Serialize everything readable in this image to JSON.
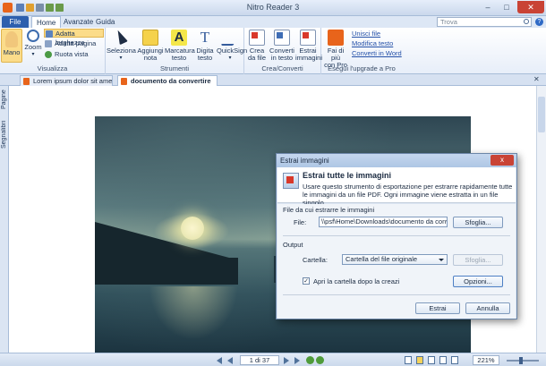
{
  "app": {
    "title": "Nitro Reader 3"
  },
  "ribbon_tabs": [
    "File",
    "Home",
    "Avanzate",
    "Guida"
  ],
  "search": {
    "placeholder": "Trova"
  },
  "ribbon": {
    "visualizza": {
      "label": "Visualizza",
      "mano": "Mano",
      "zoom": "Zoom",
      "adatta_larghezza": "Adatta larghezza",
      "adatta_pagina": "Adatta pagina",
      "ruota_vista": "Ruota vista"
    },
    "strumenti": {
      "label": "Strumenti",
      "seleziona": "Seleziona",
      "aggiungi_nota": [
        "Aggiungi",
        "nota"
      ],
      "marcatura_testo": [
        "Marcatura",
        "testo"
      ],
      "digita_testo": [
        "Digita",
        "testo"
      ],
      "quicksign": "QuickSign"
    },
    "crea_converti": {
      "label": "Crea/Converti",
      "crea_da_file": [
        "Crea",
        "da file"
      ],
      "converti_in_testo": [
        "Converti",
        "in testo"
      ],
      "estrai_immagini": [
        "Estrai",
        "immagini"
      ]
    },
    "upgrade": {
      "label": "Esegui l'upgrade a Pro",
      "fai_di_piu": [
        "Fai di più",
        "con Pro"
      ],
      "unisci_file": "Unisci file",
      "modifica_testo": "Modifica testo",
      "converti_word": "Converti in Word"
    }
  },
  "doc_tabs": [
    "Lorem ipsum dolor sit amet",
    "documento da convertire"
  ],
  "sidebar_tabs": [
    "Pagine",
    "Segnalibri"
  ],
  "statusbar": {
    "page": "1 di 37",
    "zoom": "221%"
  },
  "dialog": {
    "title": "Estrai immagini",
    "close": "x",
    "heading": "Estrai tutte le immagini",
    "description": "Usare questo strumento di esportazione per estrarre rapidamente tutte le immagini da un file PDF. Ogni immagine viene estratta in un file singolo.",
    "file_section": "File da cui estrarre le immagini",
    "file_label": "File:",
    "file_value": "\\\\psf\\Home\\Downloads\\documento da convertire",
    "browse": "Sfoglia...",
    "output_section": "Output",
    "folder_label": "Cartella:",
    "folder_value": "Cartella del file originale",
    "browse2": "Sfoglia...",
    "open_folder": "Apri la cartella dopo la creazi",
    "options": "Opzioni...",
    "extract": "Estrai",
    "cancel": "Annulla"
  }
}
